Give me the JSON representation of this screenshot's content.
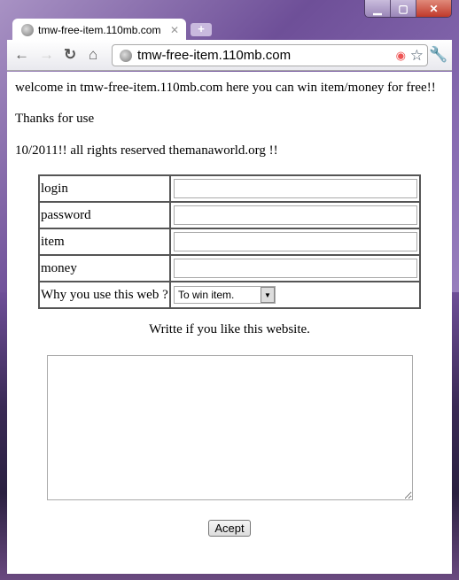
{
  "browser": {
    "tab_title": "tmw-free-item.110mb.com",
    "url": "tmw-free-item.110mb.com"
  },
  "page": {
    "intro": "welcome in tmw-free-item.110mb.com here you can win item/money for free!!",
    "thanks": "Thanks for use",
    "copyright": "10/2011!! all rights reserved themanaworld.org !!",
    "form": {
      "login_label": "login",
      "password_label": "password",
      "item_label": "item",
      "money_label": "money",
      "reason_label": "Why you use this web ?",
      "reason_value": "To win item.",
      "comment_prompt": "Writte if you like this website.",
      "submit_label": "Acept"
    }
  }
}
